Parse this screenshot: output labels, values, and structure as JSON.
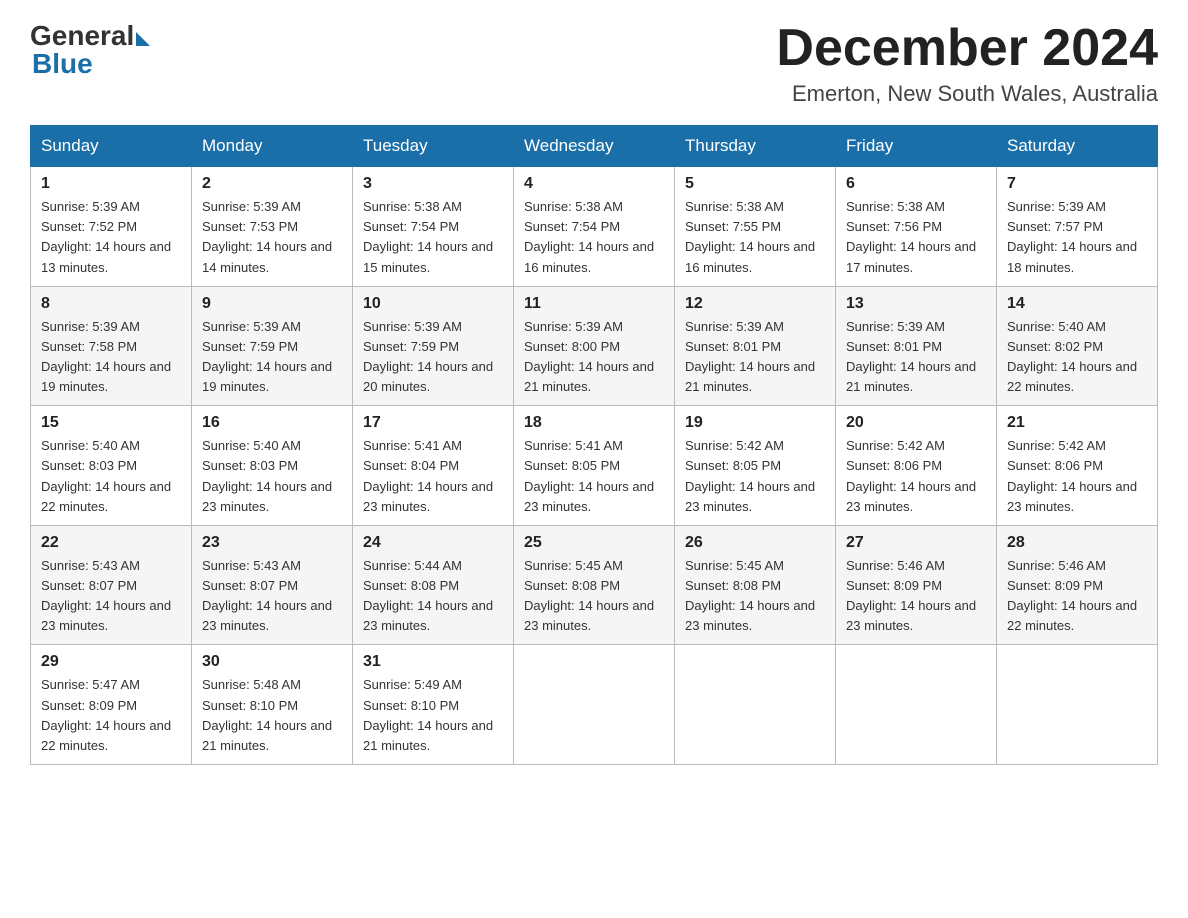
{
  "header": {
    "logo_general": "General",
    "logo_blue": "Blue",
    "month_title": "December 2024",
    "location": "Emerton, New South Wales, Australia"
  },
  "days_of_week": [
    "Sunday",
    "Monday",
    "Tuesday",
    "Wednesday",
    "Thursday",
    "Friday",
    "Saturday"
  ],
  "weeks": [
    [
      {
        "day": "1",
        "sunrise": "5:39 AM",
        "sunset": "7:52 PM",
        "daylight": "14 hours and 13 minutes."
      },
      {
        "day": "2",
        "sunrise": "5:39 AM",
        "sunset": "7:53 PM",
        "daylight": "14 hours and 14 minutes."
      },
      {
        "day": "3",
        "sunrise": "5:38 AM",
        "sunset": "7:54 PM",
        "daylight": "14 hours and 15 minutes."
      },
      {
        "day": "4",
        "sunrise": "5:38 AM",
        "sunset": "7:54 PM",
        "daylight": "14 hours and 16 minutes."
      },
      {
        "day": "5",
        "sunrise": "5:38 AM",
        "sunset": "7:55 PM",
        "daylight": "14 hours and 16 minutes."
      },
      {
        "day": "6",
        "sunrise": "5:38 AM",
        "sunset": "7:56 PM",
        "daylight": "14 hours and 17 minutes."
      },
      {
        "day": "7",
        "sunrise": "5:39 AM",
        "sunset": "7:57 PM",
        "daylight": "14 hours and 18 minutes."
      }
    ],
    [
      {
        "day": "8",
        "sunrise": "5:39 AM",
        "sunset": "7:58 PM",
        "daylight": "14 hours and 19 minutes."
      },
      {
        "day": "9",
        "sunrise": "5:39 AM",
        "sunset": "7:59 PM",
        "daylight": "14 hours and 19 minutes."
      },
      {
        "day": "10",
        "sunrise": "5:39 AM",
        "sunset": "7:59 PM",
        "daylight": "14 hours and 20 minutes."
      },
      {
        "day": "11",
        "sunrise": "5:39 AM",
        "sunset": "8:00 PM",
        "daylight": "14 hours and 21 minutes."
      },
      {
        "day": "12",
        "sunrise": "5:39 AM",
        "sunset": "8:01 PM",
        "daylight": "14 hours and 21 minutes."
      },
      {
        "day": "13",
        "sunrise": "5:39 AM",
        "sunset": "8:01 PM",
        "daylight": "14 hours and 21 minutes."
      },
      {
        "day": "14",
        "sunrise": "5:40 AM",
        "sunset": "8:02 PM",
        "daylight": "14 hours and 22 minutes."
      }
    ],
    [
      {
        "day": "15",
        "sunrise": "5:40 AM",
        "sunset": "8:03 PM",
        "daylight": "14 hours and 22 minutes."
      },
      {
        "day": "16",
        "sunrise": "5:40 AM",
        "sunset": "8:03 PM",
        "daylight": "14 hours and 23 minutes."
      },
      {
        "day": "17",
        "sunrise": "5:41 AM",
        "sunset": "8:04 PM",
        "daylight": "14 hours and 23 minutes."
      },
      {
        "day": "18",
        "sunrise": "5:41 AM",
        "sunset": "8:05 PM",
        "daylight": "14 hours and 23 minutes."
      },
      {
        "day": "19",
        "sunrise": "5:42 AM",
        "sunset": "8:05 PM",
        "daylight": "14 hours and 23 minutes."
      },
      {
        "day": "20",
        "sunrise": "5:42 AM",
        "sunset": "8:06 PM",
        "daylight": "14 hours and 23 minutes."
      },
      {
        "day": "21",
        "sunrise": "5:42 AM",
        "sunset": "8:06 PM",
        "daylight": "14 hours and 23 minutes."
      }
    ],
    [
      {
        "day": "22",
        "sunrise": "5:43 AM",
        "sunset": "8:07 PM",
        "daylight": "14 hours and 23 minutes."
      },
      {
        "day": "23",
        "sunrise": "5:43 AM",
        "sunset": "8:07 PM",
        "daylight": "14 hours and 23 minutes."
      },
      {
        "day": "24",
        "sunrise": "5:44 AM",
        "sunset": "8:08 PM",
        "daylight": "14 hours and 23 minutes."
      },
      {
        "day": "25",
        "sunrise": "5:45 AM",
        "sunset": "8:08 PM",
        "daylight": "14 hours and 23 minutes."
      },
      {
        "day": "26",
        "sunrise": "5:45 AM",
        "sunset": "8:08 PM",
        "daylight": "14 hours and 23 minutes."
      },
      {
        "day": "27",
        "sunrise": "5:46 AM",
        "sunset": "8:09 PM",
        "daylight": "14 hours and 23 minutes."
      },
      {
        "day": "28",
        "sunrise": "5:46 AM",
        "sunset": "8:09 PM",
        "daylight": "14 hours and 22 minutes."
      }
    ],
    [
      {
        "day": "29",
        "sunrise": "5:47 AM",
        "sunset": "8:09 PM",
        "daylight": "14 hours and 22 minutes."
      },
      {
        "day": "30",
        "sunrise": "5:48 AM",
        "sunset": "8:10 PM",
        "daylight": "14 hours and 21 minutes."
      },
      {
        "day": "31",
        "sunrise": "5:49 AM",
        "sunset": "8:10 PM",
        "daylight": "14 hours and 21 minutes."
      },
      null,
      null,
      null,
      null
    ]
  ]
}
